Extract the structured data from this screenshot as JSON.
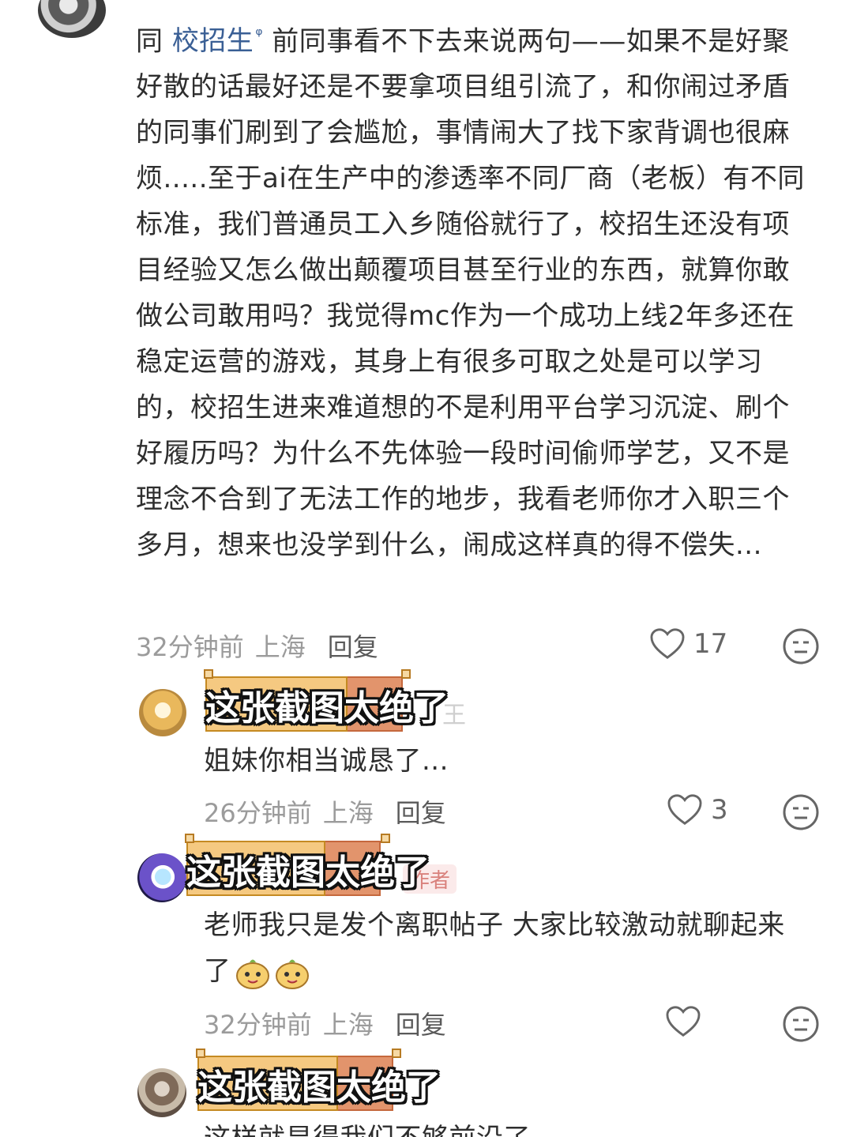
{
  "top_comment": {
    "prefix": "同 ",
    "mention": "校招生",
    "text": " 前同事看不下去来说两句——如果不是好聚好散的话最好还是不要拿项目组引流了，和你闹过矛盾的同事们刷到了会尴尬，事情闹大了找下家背调也很麻烦.....至于ai在生产中的渗透率不同厂商（老板）有不同标准，我们普通员工入乡随俗就行了，校招生还没有项目经验又怎么做出颠覆项目甚至行业的东西，就算你敢做公司敢用吗？我觉得mc作为一个成功上线2年多还在稳定运营的游戏，其身上有很多可取之处是可以学习的，校招生进来难道想的不是利用平台学习沉淀、刷个好履历吗？为什么不先体验一段时间偷师学艺，又不是理念不合到了无法工作的地步，我看老师你才入职三个多月，想来也没学到什么，闹成这样真的得不偿失...",
    "time": "32分钟前",
    "location": "上海",
    "reply_label": "回复",
    "likes": "17"
  },
  "replies": [
    {
      "banner": "这张截图太绝了",
      "peek": "王",
      "text": "姐妹你相当诚恳了...",
      "time": "26分钟前",
      "location": "上海",
      "reply_label": "回复",
      "likes": "3"
    },
    {
      "banner": "这张截图太绝了",
      "tag": "作者",
      "text": "老师我只是发个离职帖子 大家比较激动就聊起来了",
      "time": "32分钟前",
      "location": "上海",
      "reply_label": "回复",
      "likes": ""
    },
    {
      "banner": "这张截图太绝了",
      "text": "这样就显得我们不够前沿了"
    }
  ],
  "colors": {
    "mention": "#3a5f95",
    "banner_light": "#f5c981",
    "banner_dark": "#e2946c",
    "meta": "#9b9b9b"
  },
  "icons": [
    "heart-icon",
    "dislike-face-icon",
    "emoji-icon"
  ]
}
